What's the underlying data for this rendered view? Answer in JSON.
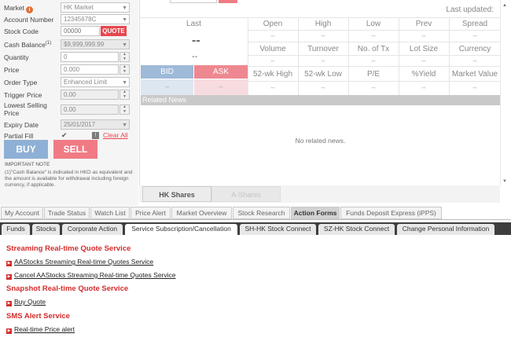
{
  "order_form": {
    "market": {
      "label": "Market",
      "value": "HK Market"
    },
    "account_number": {
      "label": "Account Number",
      "value": "12345678C"
    },
    "stock_code": {
      "label": "Stock Code",
      "placeholder": "00000",
      "quote_label": "QUOTE"
    },
    "cash_balance": {
      "label": "Cash Balance",
      "marker": "(1)",
      "value": "$9,999,999.99"
    },
    "quantity": {
      "label": "Quantity",
      "value": "0"
    },
    "price": {
      "label": "Price",
      "value": "0.000"
    },
    "order_type": {
      "label": "Order Type",
      "value": "Enhanced Limit"
    },
    "trigger_price": {
      "label": "Trigger Price",
      "value": "0.00"
    },
    "lowest_selling_price": {
      "label": "Lowest Selling Price",
      "value": "0.00"
    },
    "expiry_date": {
      "label": "Expiry Date",
      "value": "25/01/2017"
    },
    "partial_fill": {
      "label": "Partial Fill",
      "checkmark": "✔",
      "clear_all": "Clear All"
    },
    "buy_label": "BUY",
    "sell_label": "SELL",
    "important_note": "IMPORTANT NOTE",
    "note_text": "(1)\"Cash Balance\" is indicated in HKD as equivalent and the amount is available for withdrawal including foreign currency, if applicable."
  },
  "quote": {
    "last_updated": "Last updated:",
    "last_label": "Last",
    "last_value": "--",
    "last_change": "--",
    "dash": "--",
    "row1_headers": [
      "Open",
      "High",
      "Low",
      "Prev",
      "Spread"
    ],
    "row2_headers": [
      "Volume",
      "Turnover",
      "No. of Tx",
      "Lot Size",
      "Currency"
    ],
    "row3_headers": [
      "52-wk High",
      "52-wk Low",
      "P/E",
      "%Yield",
      "Market Value"
    ],
    "bid_label": "BID",
    "ask_label": "ASK",
    "bid_value": "--",
    "ask_value": "--",
    "related_news": "Related News",
    "no_news": "No related news."
  },
  "share_tabs": [
    "HK Shares",
    "A-Shares"
  ],
  "main_tabs": [
    "My Account",
    "Trade Status",
    "Watch List",
    "Price Alert",
    "Market Overview",
    "Stock Research",
    "Action Forms",
    "Funds Deposit Express (iPPS)"
  ],
  "sub_tabs": [
    "Funds",
    "Stocks",
    "Corporate Action",
    "Service Subscription/Cancellation",
    "SH-HK Stock Connect",
    "SZ-HK Stock Connect",
    "Change Personal Information"
  ],
  "content": {
    "streaming_title": "Streaming Real-time Quote Service",
    "streaming_link": "AAStocks Streaming Real-time Quotes Service",
    "cancel_link": "Cancel AAStocks Streaming Real-time Quotes Service",
    "snapshot_title": "Snapshot Real-time Quote Service",
    "buy_quote_link": "Buy Quote",
    "sms_title": "SMS Alert Service",
    "price_alert_link": "Real-time Price alert"
  },
  "colors": {
    "buy": "#8fb0d6",
    "sell": "#f07b84",
    "accent_red": "#d62b2b",
    "quote_red": "#e8474f",
    "sub_tab_bar": "#3e3e3e"
  }
}
